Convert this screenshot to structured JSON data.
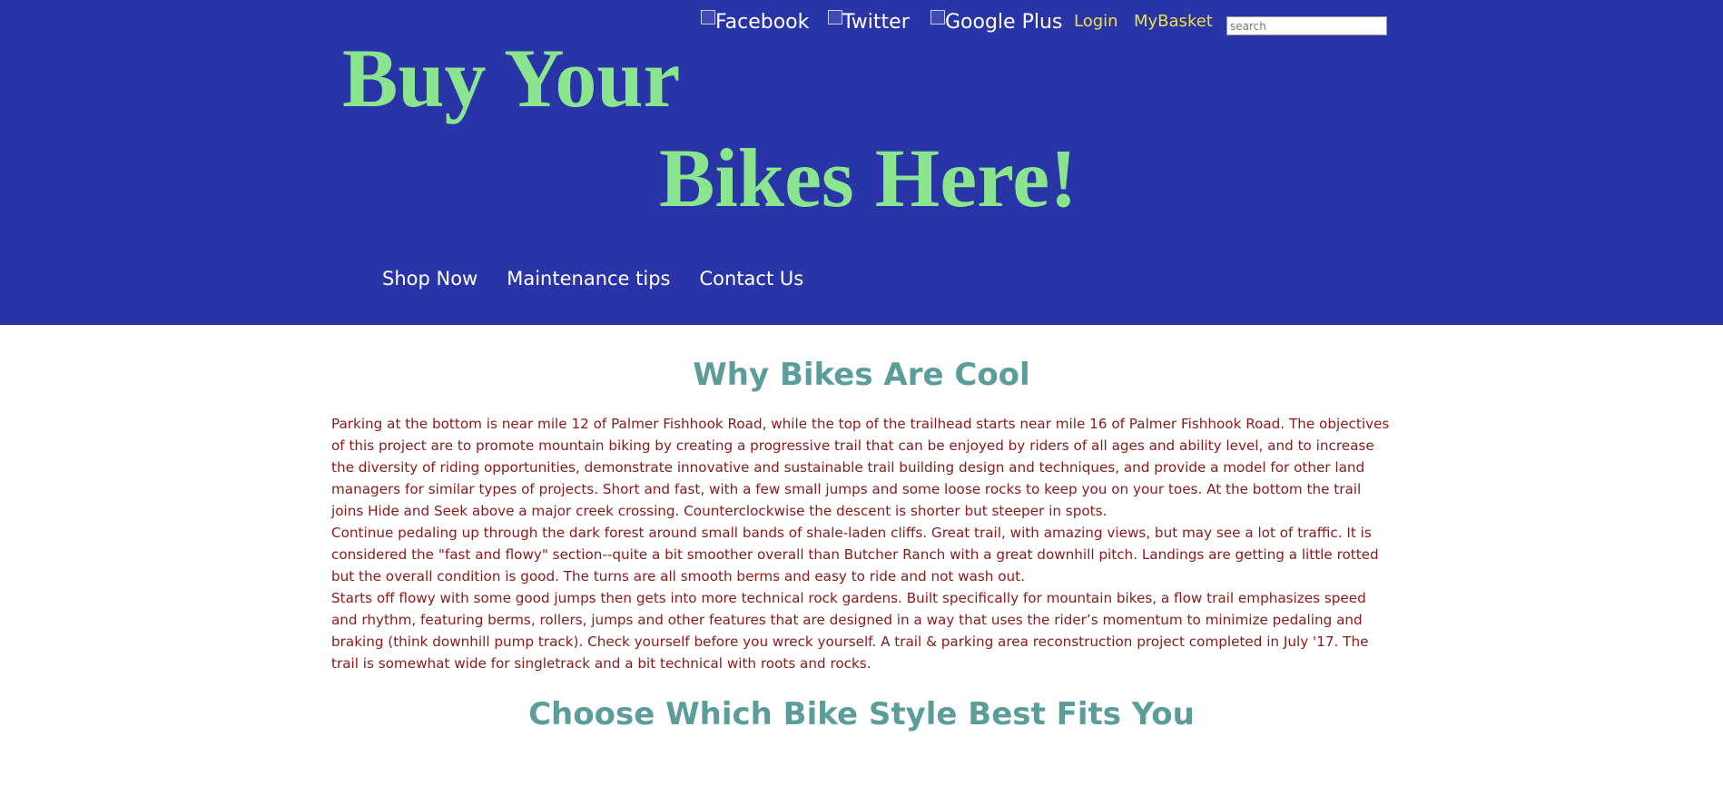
{
  "header": {
    "social": {
      "facebook_alt": "Facebook",
      "twitter_alt": "Twitter",
      "google_plus_alt": "Google Plus"
    },
    "links": {
      "login": "Login",
      "basket": "MyBasket"
    },
    "search": {
      "placeholder": "search",
      "value": ""
    },
    "headline": {
      "line1": "Buy Your",
      "line2": "Bikes Here!"
    },
    "nav": [
      "Shop Now",
      "Maintenance tips",
      "Contact Us"
    ]
  },
  "main": {
    "section1_title": "Why Bikes Are Cool",
    "paragraphs": [
      "Parking at the bottom is near mile 12 of Palmer Fishhook Road, while the top of the trailhead starts near mile 16 of Palmer Fishhook Road. The objectives of this project are to promote mountain biking by creating a progressive trail that can be enjoyed by riders of all ages and ability level, and to increase the diversity of riding opportunities, demonstrate innovative and sustainable trail building design and techniques, and provide a model for other land managers for similar types of projects. Short and fast, with a few small jumps and some loose rocks to keep you on your toes. At the bottom the trail joins Hide and Seek above a major creek crossing. Counterclockwise the descent is shorter but steeper in spots.",
      "Continue pedaling up through the dark forest around small bands of shale-laden cliffs. Great trail, with amazing views, but may see a lot of traffic. It is considered the \"fast and flowy\" section--quite a bit smoother overall than Butcher Ranch with a great downhill pitch. Landings are getting a little rotted but the overall condition is good. The turns are all smooth berms and easy to ride and not wash out.",
      "Starts off flowy with some good jumps then gets into more technical rock gardens. Built specifically for mountain bikes, a flow trail emphasizes speed and rhythm, featuring berms, rollers, jumps and other features that are designed in a way that uses the rider’s momentum to minimize pedaling and braking (think downhill pump track). Check yourself before you wreck yourself. A trail & parking area reconstruction project completed in July '17. The trail is somewhat wide for singletrack and a bit technical with roots and rocks."
    ],
    "section2_title": "Choose Which Bike Style Best Fits You"
  },
  "colors": {
    "header_bg": "#2935a7",
    "headline": "#8ae58e",
    "top_links": "#e9e04f",
    "section_title": "#5b9d9b",
    "body_text": "#8a1a1a"
  }
}
